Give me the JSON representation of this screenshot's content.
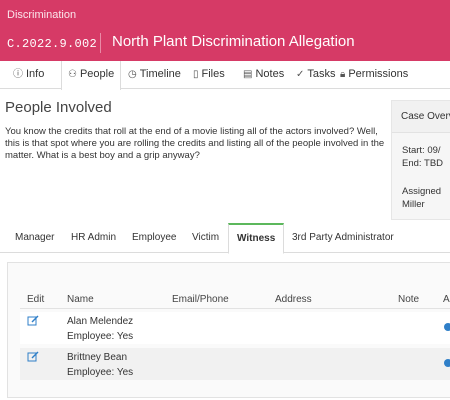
{
  "header": {
    "category": "Discrimination",
    "case_id": "C.2022.9.002",
    "title": "North Plant Discrimination Allegation"
  },
  "tabs": [
    {
      "label": "Info",
      "icon": "info-icon"
    },
    {
      "label": "People",
      "icon": "person-icon",
      "active": true
    },
    {
      "label": "Timeline",
      "icon": "clock-icon"
    },
    {
      "label": "Files",
      "icon": "file-icon"
    },
    {
      "label": "Notes",
      "icon": "note-icon"
    },
    {
      "label": "Tasks",
      "icon": "check-icon"
    },
    {
      "label": "Permissions",
      "icon": "lock-icon"
    }
  ],
  "section": {
    "title": "People Involved",
    "intro": "You know the credits that roll at the end of a movie listing all of the actors involved? Well, this is that spot where you are rolling the credits and listing all of the people involved in the matter. What is a best boy and a grip anyway?"
  },
  "overview": {
    "title": "Case Overview",
    "start": "Start: 09/",
    "end": "End: TBD",
    "assigned": "Assigned",
    "assignee": "Miller"
  },
  "people_tabs": [
    {
      "label": "Manager"
    },
    {
      "label": "HR Admin"
    },
    {
      "label": "Employee"
    },
    {
      "label": "Victim"
    },
    {
      "label": "Witness",
      "active": true
    },
    {
      "label": "3rd Party Administrator"
    }
  ],
  "table": {
    "columns": [
      "Edit",
      "Name",
      "Email/Phone",
      "Address",
      "Note",
      "A"
    ],
    "rows": [
      {
        "name": "Alan Melendez",
        "employee": "Employee: Yes"
      },
      {
        "name": "Brittney Bean",
        "employee": "Employee: Yes"
      }
    ]
  },
  "colors": {
    "header_bg": "#d63a66",
    "active_tab_accent": "#5cb85c",
    "link_blue": "#2f7fc8"
  }
}
